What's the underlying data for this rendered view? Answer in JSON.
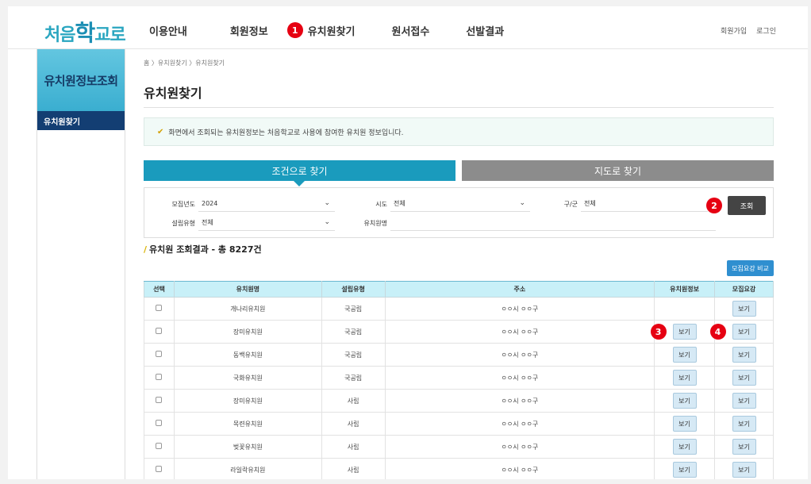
{
  "header": {
    "logo": {
      "pre": "처음",
      "big": "학",
      "post": "교로"
    },
    "nav": [
      {
        "label": "이용안내",
        "badge": ""
      },
      {
        "label": "회원정보",
        "badge": ""
      },
      {
        "label": "유치원찾기",
        "badge": "1"
      },
      {
        "label": "원서접수",
        "badge": ""
      },
      {
        "label": "선발결과",
        "badge": ""
      }
    ],
    "util": {
      "signup": "회원가입",
      "login": "로그인"
    }
  },
  "sidebar": {
    "title": "유치원정보조회",
    "items": [
      {
        "label": "유치원찾기"
      }
    ]
  },
  "main": {
    "breadcrumb": "홈 〉유치원찾기 〉유치원찾기",
    "title": "유치원찾기",
    "notice": "화면에서 조회되는 유치원정보는 처음학교로 사용에 참여한 유치원 정보입니다.",
    "tabs": {
      "condition": "조건으로 찾기",
      "map": "지도로 찾기"
    },
    "search": {
      "year_label": "모집년도",
      "year_value": "2024",
      "sido_label": "시도",
      "sido_value": "전체",
      "gugun_label": "구/군",
      "gugun_value": "전체",
      "type_label": "설립유형",
      "type_value": "전체",
      "name_label": "유치원명",
      "name_value": "",
      "button": "조회",
      "button_badge": "2"
    },
    "result_title": "유치원 조회결과 - 총 8227건",
    "compare_button": "모집요강 비교",
    "table": {
      "headers": [
        "선택",
        "유치원명",
        "설립유형",
        "주소",
        "유치원정보",
        "모집요강"
      ],
      "rows": [
        {
          "name": "개나리유치원",
          "type": "국공립",
          "addr": "ㅇㅇ시 ㅇㅇ구",
          "info": "",
          "recruit": "보기"
        },
        {
          "name": "장미유치원",
          "type": "국공립",
          "addr": "ㅇㅇ시 ㅇㅇ구",
          "info": "보기",
          "recruit": "보기"
        },
        {
          "name": "동백유치원",
          "type": "국공립",
          "addr": "ㅇㅇ시 ㅇㅇ구",
          "info": "보기",
          "recruit": "보기"
        },
        {
          "name": "국화유치원",
          "type": "국공립",
          "addr": "ㅇㅇ시 ㅇㅇ구",
          "info": "보기",
          "recruit": "보기"
        },
        {
          "name": "장미유치원",
          "type": "사립",
          "addr": "ㅇㅇ시 ㅇㅇ구",
          "info": "보기",
          "recruit": "보기"
        },
        {
          "name": "목련유치원",
          "type": "사립",
          "addr": "ㅇㅇ시 ㅇㅇ구",
          "info": "보기",
          "recruit": "보기"
        },
        {
          "name": "벚꽃유치원",
          "type": "사립",
          "addr": "ㅇㅇ시 ㅇㅇ구",
          "info": "보기",
          "recruit": "보기"
        },
        {
          "name": "라일락유치원",
          "type": "사립",
          "addr": "ㅇㅇ시 ㅇㅇ구",
          "info": "보기",
          "recruit": "보기"
        }
      ],
      "badges": {
        "info": "3",
        "recruit": "4"
      }
    }
  },
  "colors": {
    "accent": "#1a9bbd",
    "badge": "#e60012",
    "sidebar_active": "#133e73"
  }
}
